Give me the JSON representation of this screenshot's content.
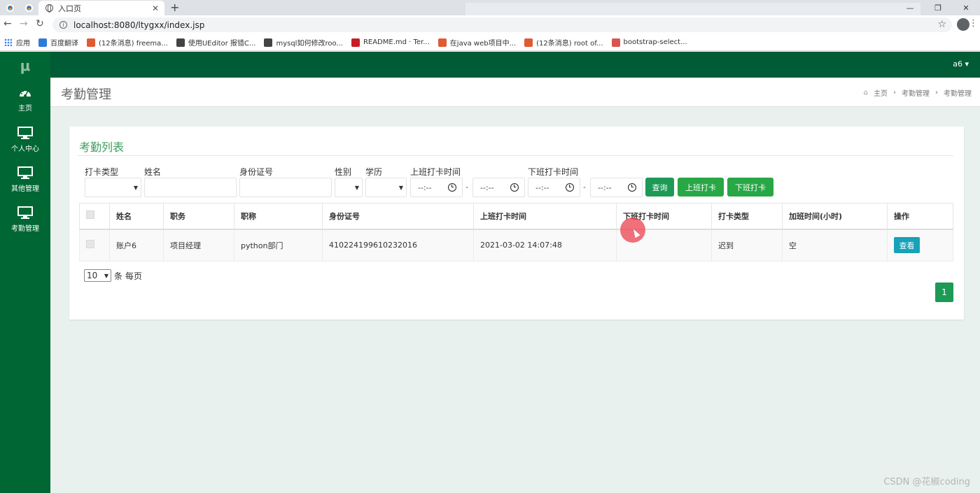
{
  "browser": {
    "tab_title": "入口页",
    "tab_close": "✕",
    "new_tab": "+",
    "url": "localhost:8080/ltygxx/index.jsp",
    "window_controls": [
      "—",
      "❐",
      "✕"
    ],
    "bookmarks": [
      {
        "label": "应用",
        "icon": "apps-icon"
      },
      {
        "label": "百度翻译",
        "icon": "translate-icon",
        "color": "#2f7bd7"
      },
      {
        "label": "(12条消息) freema...",
        "icon": "csdn-icon",
        "color": "#e05a33"
      },
      {
        "label": "使用UEditor 报错C...",
        "icon": "web-icon",
        "color": "#444444"
      },
      {
        "label": "mysql如何修改roo...",
        "icon": "web-icon",
        "color": "#444444"
      },
      {
        "label": "README.md · Ter...",
        "icon": "gitee-icon",
        "color": "#c71d23"
      },
      {
        "label": "在java web项目中...",
        "icon": "csdn-icon",
        "color": "#e05a33"
      },
      {
        "label": "(12条消息) root of...",
        "icon": "csdn-icon",
        "color": "#e05a33"
      },
      {
        "label": "bootstrap-select...",
        "icon": "doc-icon",
        "color": "#d9534f"
      }
    ]
  },
  "sidebar": {
    "logo": "μ",
    "items": [
      {
        "label": "主页",
        "icon": "dashboard-icon"
      },
      {
        "label": "个人中心",
        "icon": "monitor-icon"
      },
      {
        "label": "其他管理",
        "icon": "monitor-icon"
      },
      {
        "label": "考勤管理",
        "icon": "monitor-icon"
      }
    ]
  },
  "topbar": {
    "user": "a6 ▾"
  },
  "header": {
    "title": "考勤管理",
    "breadcrumb": [
      "主页",
      "考勤管理",
      "考勤管理"
    ],
    "separator": "›"
  },
  "card": {
    "title": "考勤列表",
    "filters": {
      "punch_type_label": "打卡类型",
      "name_label": "姓名",
      "id_label": "身份证号",
      "gender_label": "性别",
      "education_label": "学历",
      "checkin_time_label": "上班打卡时间",
      "checkout_time_label": "下班打卡时间",
      "time_placeholder": "--:--",
      "dash": "-"
    },
    "buttons": {
      "query": "查询",
      "checkin": "上班打卡",
      "checkout": "下班打卡"
    },
    "table": {
      "headers": [
        "",
        "姓名",
        "职务",
        "职称",
        "身份证号",
        "上班打卡时间",
        "下班打卡时间",
        "打卡类型",
        "加班时间(小时)",
        "操作"
      ],
      "rows": [
        {
          "name": "账户6",
          "position": "项目经理",
          "title": "python部门",
          "id_number": "410224199610232016",
          "checkin": "2021-03-02 14:07:48",
          "checkout": "",
          "type": "迟到",
          "overtime": "空",
          "action": "查看"
        }
      ]
    },
    "page_size": {
      "value": "10",
      "suffix": "条 每页"
    },
    "current_page": "1"
  },
  "watermark": "CSDN @花椒coding",
  "colors": {
    "sidebar": "#006633",
    "topbar": "#005c35",
    "accent": "#1d9a56",
    "view_button": "#17a2b8"
  }
}
